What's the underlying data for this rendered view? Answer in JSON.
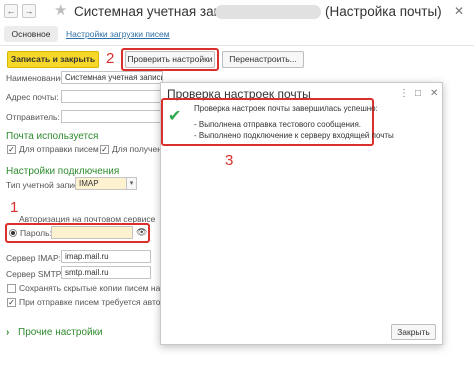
{
  "window": {
    "back_glyph": "←",
    "forward_glyph": "→",
    "star_glyph": "★",
    "title_prefix": "Системная учетная запись",
    "title_suffix": "(Настройка почты)",
    "close_glyph": "✕"
  },
  "tabs": {
    "main": "Основное",
    "download": "Настройки загрузки писем"
  },
  "toolbar": {
    "save_close": "Записать и закрыть",
    "check_settings": "Проверить настройки",
    "reconfigure": "Перенастроить..."
  },
  "form": {
    "name_label": "Наименование:",
    "name_value": "Системная учетная запись",
    "address_label": "Адрес почты:",
    "sender_label": "Отправитель:",
    "mail_used_heading": "Почта используется",
    "for_sending_label": "Для отправки писем",
    "for_receiving_label": "Для получения пис",
    "connection_heading": "Настройки подключения",
    "account_type_label": "Тип учетной записи:",
    "account_type_value": "IMAP",
    "auth_label": "Авторизация на почтовом сервисе",
    "password_label": "Пароль:",
    "imap_label": "Сервер IMAP:",
    "imap_value": "imap.mail.ru",
    "smtp_label": "Сервер SMTP:",
    "smtp_value": "smtp.mail.ru",
    "save_copies_label": "Сохранять скрытые копии писем на это",
    "auth_required_label": "При отправке писем требуется авторизац",
    "other_settings": "Прочие настройки",
    "chevron_glyph": "›"
  },
  "annotations": {
    "step1": "1",
    "step2": "2",
    "step3": "3"
  },
  "dialog": {
    "title": "Проверка настроек почты",
    "menu_glyph": "⋮",
    "maximize_glyph": "□",
    "close_glyph": "✕",
    "check_glyph": "✔",
    "success_msg": "Проверка настроек почты завершилась успешно:",
    "line1": "- Выполнена отправка тестового сообщения.",
    "line2": "- Выполнено подключение к серверу входящей почты",
    "close_button": "Закрыть"
  },
  "colors": {
    "accent_yellow": "#f6d82a",
    "annotation_red": "#d9302c",
    "heading_green": "#2e8b2e",
    "link_blue": "#2c6fa8"
  }
}
